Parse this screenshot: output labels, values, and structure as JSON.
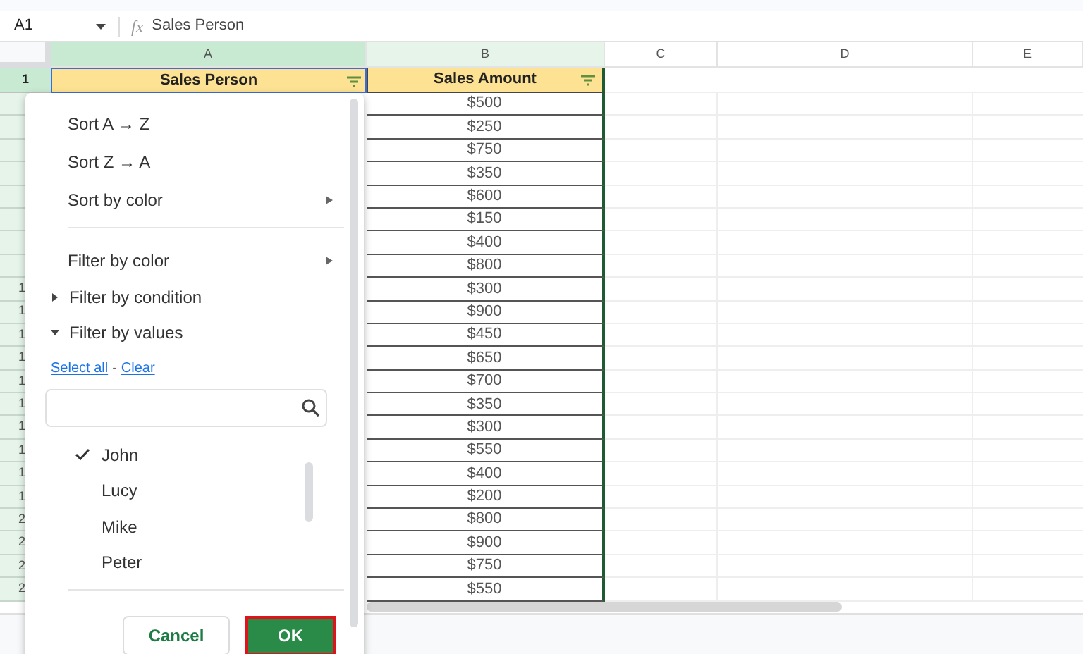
{
  "formula_bar": {
    "cell_ref": "A1",
    "fx": "fx",
    "value": "Sales Person"
  },
  "columns": [
    {
      "label": "A",
      "selected": true
    },
    {
      "label": "B",
      "selected": true
    },
    {
      "label": "C",
      "selected": false
    },
    {
      "label": "D",
      "selected": false
    },
    {
      "label": "E",
      "selected": false
    }
  ],
  "header_row": {
    "number": "1",
    "cells": [
      "Sales Person",
      "Sales Amount"
    ]
  },
  "rows": [
    {
      "amount": "$500"
    },
    {
      "amount": "$250"
    },
    {
      "amount": "$750"
    },
    {
      "amount": "$350"
    },
    {
      "amount": "$600"
    },
    {
      "amount": "$150"
    },
    {
      "amount": "$400"
    },
    {
      "amount": "$800"
    },
    {
      "number": "1",
      "amount": "$300"
    },
    {
      "number": "1",
      "amount": "$900"
    },
    {
      "number": "1",
      "amount": "$450"
    },
    {
      "number": "1",
      "amount": "$650"
    },
    {
      "number": "1",
      "amount": "$700"
    },
    {
      "number": "1",
      "amount": "$350"
    },
    {
      "number": "1",
      "amount": "$300"
    },
    {
      "number": "1",
      "amount": "$550"
    },
    {
      "number": "1",
      "amount": "$400"
    },
    {
      "number": "1",
      "amount": "$200"
    },
    {
      "number": "2",
      "amount": "$800"
    },
    {
      "number": "2",
      "amount": "$900"
    },
    {
      "number": "2",
      "amount": "$750"
    },
    {
      "number": "2",
      "amount": "$550"
    }
  ],
  "filter_menu": {
    "items": [
      {
        "kind": "item",
        "label": "Sort A → Z"
      },
      {
        "kind": "item",
        "label": "Sort Z → A"
      },
      {
        "kind": "submenu",
        "label": "Sort by color"
      },
      {
        "kind": "divider"
      },
      {
        "kind": "submenu",
        "label": "Filter by color"
      },
      {
        "kind": "section",
        "label": "Filter by condition",
        "expanded": false
      },
      {
        "kind": "section",
        "label": "Filter by values",
        "expanded": true
      }
    ],
    "select_all": "Select all",
    "separator": "-",
    "clear": "Clear",
    "values": [
      {
        "label": "John",
        "checked": true
      },
      {
        "label": "Lucy",
        "checked": false
      },
      {
        "label": "Mike",
        "checked": false
      },
      {
        "label": "Peter",
        "checked": false
      }
    ],
    "cancel": "Cancel",
    "ok": "OK"
  }
}
